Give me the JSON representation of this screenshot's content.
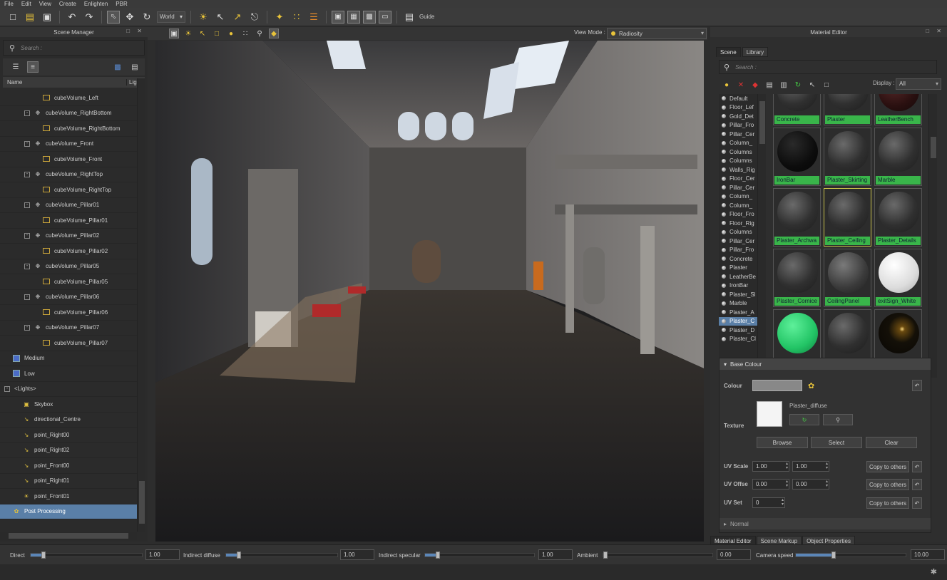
{
  "menu": [
    "File",
    "Edit",
    "View",
    "Create",
    "Enlighten",
    "PBR"
  ],
  "toolbar": {
    "world": "World",
    "guide": "Guide"
  },
  "scene_manager": {
    "title": "Scene Manager",
    "search_placeholder": "Search :",
    "col_name": "Name",
    "col_light": "Ligh",
    "rows": [
      {
        "label": "cubeVolume_Left",
        "type": "cube",
        "indent": 60
      },
      {
        "label": "cubeVolume_RightBottom",
        "type": "probe",
        "indent": 34,
        "exp": "-"
      },
      {
        "label": "cubeVolume_RightBottom",
        "type": "cube",
        "indent": 60
      },
      {
        "label": "cubeVolume_Front",
        "type": "probe",
        "indent": 34,
        "exp": "-"
      },
      {
        "label": "cubeVolume_Front",
        "type": "cube",
        "indent": 60
      },
      {
        "label": "cubeVolume_RightTop",
        "type": "probe",
        "indent": 34,
        "exp": "-"
      },
      {
        "label": "cubeVolume_RightTop",
        "type": "cube",
        "indent": 60
      },
      {
        "label": "cubeVolume_Pillar01",
        "type": "probe",
        "indent": 34,
        "exp": "-"
      },
      {
        "label": "cubeVolume_Pillar01",
        "type": "cube",
        "indent": 60
      },
      {
        "label": "cubeVolume_Pillar02",
        "type": "probe",
        "indent": 34,
        "exp": "-"
      },
      {
        "label": "cubeVolume_Pillar02",
        "type": "cube",
        "indent": 60
      },
      {
        "label": "cubeVolume_Pillar05",
        "type": "probe",
        "indent": 34,
        "exp": "-"
      },
      {
        "label": "cubeVolume_Pillar05",
        "type": "cube",
        "indent": 60
      },
      {
        "label": "cubeVolume_Pillar06",
        "type": "probe",
        "indent": 34,
        "exp": "-"
      },
      {
        "label": "cubeVolume_Pillar06",
        "type": "cube",
        "indent": 60
      },
      {
        "label": "cubeVolume_Pillar07",
        "type": "probe",
        "indent": 34,
        "exp": "-"
      },
      {
        "label": "cubeVolume_Pillar07",
        "type": "cube",
        "indent": 60
      },
      {
        "label": "Medium",
        "type": "lvl",
        "indent": 18
      },
      {
        "label": "Low",
        "type": "lvl",
        "indent": 18
      },
      {
        "label": "<Lights>",
        "type": "none",
        "indent": 6,
        "exp": "-"
      },
      {
        "label": "Skybox",
        "type": "sky",
        "indent": 32
      },
      {
        "label": "directional_Centre",
        "type": "dir",
        "indent": 32
      },
      {
        "label": "point_Right00",
        "type": "pt",
        "indent": 32
      },
      {
        "label": "point_Right02",
        "type": "pt",
        "indent": 32
      },
      {
        "label": "point_Front00",
        "type": "pt",
        "indent": 32
      },
      {
        "label": "point_Right01",
        "type": "pt",
        "indent": 32
      },
      {
        "label": "point_Front01",
        "type": "sun",
        "indent": 32
      },
      {
        "label": "Post Processing",
        "type": "pp",
        "indent": 18,
        "sel": true
      }
    ]
  },
  "viewport": {
    "view_mode_label": "View Mode :",
    "view_mode": "Radiosity"
  },
  "material_editor": {
    "title": "Material Editor",
    "tabs": [
      "Scene",
      "Library"
    ],
    "search_placeholder": "Search :",
    "display_label": "Display :",
    "display_value": "All",
    "list": [
      "Default",
      "Floor_Lef",
      "Gold_Det",
      "Pillar_Fro",
      "Pillar_Cer",
      "Column_",
      "Columns",
      "Columns",
      "Walls_Rig",
      "Floor_Cer",
      "Pillar_Cer",
      "Column_",
      "Column_",
      "Floor_Fro",
      "Floor_Rig",
      "Columns",
      "Pillar_Cer",
      "Pillar_Fro",
      "Concrete",
      "Plaster",
      "LeatherBe",
      "IronBar",
      "Plaster_Sl",
      "Marble",
      "Plaster_A",
      "Plaster_C",
      "Plaster_D",
      "Plaster_Cl"
    ],
    "list_selected": 25,
    "thumbs": [
      {
        "label": "Concrete",
        "kind": "dark"
      },
      {
        "label": "Plaster",
        "kind": "dark"
      },
      {
        "label": "LeatherBench",
        "kind": "red"
      },
      {
        "label": "IronBar",
        "kind": "black"
      },
      {
        "label": "Plaster_Skirting",
        "kind": "dark"
      },
      {
        "label": "Marble",
        "kind": "dark"
      },
      {
        "label": "Plaster_Archwa",
        "kind": "dark"
      },
      {
        "label": "Plaster_Ceiling",
        "kind": "dark",
        "hl": true
      },
      {
        "label": "Plaster_Details",
        "kind": "dark"
      },
      {
        "label": "Plaster_Cornice",
        "kind": "dark"
      },
      {
        "label": "CeilingPanel",
        "kind": "dots"
      },
      {
        "label": "exitSign_White",
        "kind": "white"
      },
      {
        "label": "",
        "kind": "green"
      },
      {
        "label": "",
        "kind": "dark"
      },
      {
        "label": "",
        "kind": "gold"
      }
    ],
    "base_colour": {
      "header": "Base Colour",
      "colour_label": "Colour",
      "texture_label": "Texture",
      "texture_name": "Plaster_diffuse",
      "browse": "Browse",
      "select": "Select",
      "clear": "Clear",
      "uv_scale_label": "UV Scale",
      "uv_offset_label": "UV Offse",
      "uv_set_label": "UV Set",
      "uv_scale": [
        "1.00",
        "1.00"
      ],
      "uv_offset": [
        "0.00",
        "0.00"
      ],
      "uv_set": "0",
      "copy": "Copy to others"
    },
    "normal_header": "Normal",
    "bottom_tabs": [
      "Material Editor",
      "Scene Markup",
      "Object Properties"
    ]
  },
  "status": {
    "direct": "Direct",
    "direct_val": "1.00",
    "direct_fill": 0.12,
    "indirect_diffuse": "Indirect diffuse",
    "indirect_diffuse_val": "1.00",
    "indirect_diffuse_fill": 0.12,
    "indirect_specular": "Indirect specular",
    "indirect_specular_val": "1.00",
    "indirect_specular_fill": 0.12,
    "ambient": "Ambient",
    "ambient_val": "0.00",
    "ambient_fill": 0.0,
    "camera_speed": "Camera speed",
    "camera_speed_val": "10.00",
    "camera_speed_fill": 0.35
  }
}
